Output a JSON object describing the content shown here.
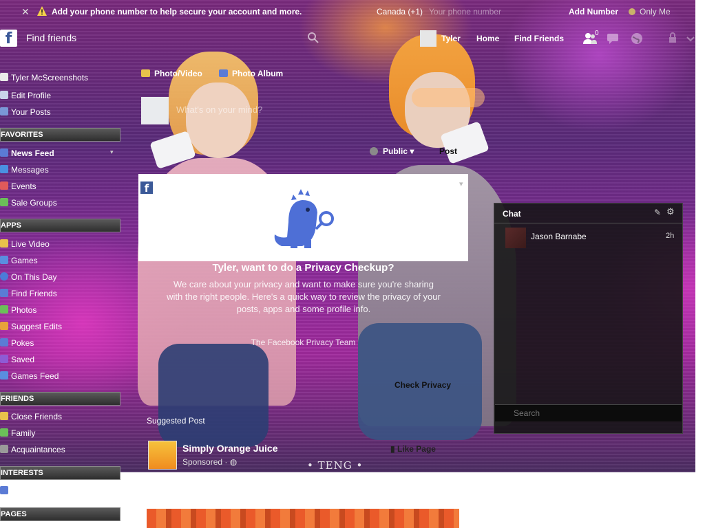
{
  "banner": {
    "message": "Add your phone number to help secure your account and more.",
    "country": "Canada (+1)",
    "phone_placeholder": "Your phone number",
    "add_number": "Add Number",
    "privacy": "Only Me"
  },
  "nav": {
    "search_label": "Find friends",
    "user": "Tyler",
    "home": "Home",
    "find_friends": "Find Friends",
    "friend_requests": "0"
  },
  "sidebar": {
    "profile": [
      {
        "label": "Tyler McScreenshots"
      },
      {
        "label": "Edit Profile"
      },
      {
        "label": "Your Posts"
      }
    ],
    "favorites_header": "FAVORITES",
    "favorites": [
      {
        "label": "News Feed"
      },
      {
        "label": "Messages"
      },
      {
        "label": "Events"
      },
      {
        "label": "Sale Groups"
      }
    ],
    "apps_header": "APPS",
    "apps": [
      {
        "label": "Live Video"
      },
      {
        "label": "Games"
      },
      {
        "label": "On This Day"
      },
      {
        "label": "Find Friends"
      },
      {
        "label": "Photos"
      },
      {
        "label": "Suggest Edits"
      },
      {
        "label": "Pokes"
      },
      {
        "label": "Saved"
      },
      {
        "label": "Games Feed"
      }
    ],
    "friends_header": "FRIENDS",
    "friends": [
      {
        "label": "Close Friends"
      },
      {
        "label": "Family"
      },
      {
        "label": "Acquaintances"
      }
    ],
    "interests_header": "INTERESTS",
    "pages_header": "PAGES"
  },
  "composer": {
    "photo_video": "Photo/Video",
    "photo_album": "Photo Album",
    "placeholder": "What's on your mind?",
    "audience": "Public",
    "post": "Post"
  },
  "privacy_card": {
    "title": "Tyler, want to do a Privacy Checkup?",
    "body": "We care about your privacy and want to make sure you're sharing with the right people. Here's a quick way to review the privacy of your posts, apps and some profile info.",
    "signature": "The Facebook Privacy Team",
    "button": "Check Privacy"
  },
  "suggested_post": {
    "label": "Suggested Post",
    "page_name": "Simply Orange Juice",
    "sponsored": "Sponsored · ",
    "like_page": "Like Page"
  },
  "chat": {
    "title": "Chat",
    "contacts": [
      {
        "name": "Jason Barnabe",
        "time": "2h"
      }
    ],
    "search_placeholder": "Search"
  },
  "wallpaper": {
    "watermark": "• TENG •"
  },
  "colors": {
    "facebook_blue": "#3b5998",
    "privacy_dino": "#4e6fd6"
  }
}
